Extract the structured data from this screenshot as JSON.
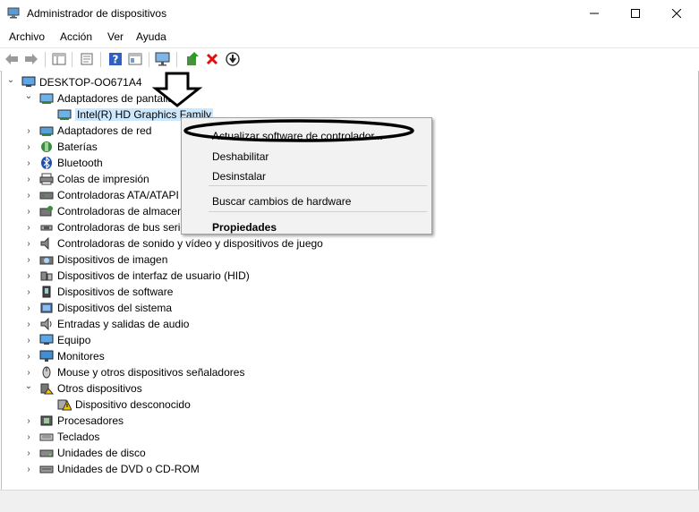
{
  "window": {
    "title": "Administrador de dispositivos",
    "minimize_symbol": "—",
    "maximize_symbol": "☐",
    "close_symbol": "✕"
  },
  "menu": [
    "Archivo",
    "Acción",
    "Ver",
    "Ayuda"
  ],
  "toolbar": {
    "buttons": [
      "back-arrow-icon",
      "forward-arrow-icon",
      "properties-icon",
      "show-hide-icon",
      "help-icon",
      "view-icon",
      "monitor-scan-icon",
      "update-driver-icon",
      "uninstall-x-icon",
      "download-icon"
    ]
  },
  "tree": {
    "root": "DESKTOP-OO671A4",
    "items": [
      {
        "label": "Adaptadores de pantalla",
        "icon": "display-adapter-icon",
        "expanded": true
      },
      {
        "label": "Intel(R) HD Graphics Family",
        "icon": "display-adapter-icon",
        "child": true,
        "selected": true
      },
      {
        "label": "Adaptadores de red",
        "icon": "network-adapter-icon"
      },
      {
        "label": "Baterías",
        "icon": "battery-icon"
      },
      {
        "label": "Bluetooth",
        "icon": "bluetooth-icon"
      },
      {
        "label": "Colas de impresión",
        "icon": "printer-icon"
      },
      {
        "label": "Controladoras ATA/ATAPI",
        "icon": "ata-controller-icon"
      },
      {
        "label": "Controladoras de almacenamiento",
        "icon": "storage-controller-icon"
      },
      {
        "label": "Controladoras de bus serie universal",
        "icon": "usb-icon"
      },
      {
        "label": "Controladoras de sonido y vídeo y dispositivos de juego",
        "icon": "sound-icon"
      },
      {
        "label": "Dispositivos de imagen",
        "icon": "camera-icon"
      },
      {
        "label": "Dispositivos de interfaz de usuario (HID)",
        "icon": "hid-icon"
      },
      {
        "label": "Dispositivos de software",
        "icon": "software-device-icon"
      },
      {
        "label": "Dispositivos del sistema",
        "icon": "system-device-icon"
      },
      {
        "label": "Entradas y salidas de audio",
        "icon": "audio-io-icon"
      },
      {
        "label": "Equipo",
        "icon": "computer-icon"
      },
      {
        "label": "Monitores",
        "icon": "monitor-icon"
      },
      {
        "label": "Mouse y otros dispositivos señaladores",
        "icon": "mouse-icon"
      },
      {
        "label": "Otros dispositivos",
        "icon": "other-devices-icon",
        "expanded": true
      },
      {
        "label": "Dispositivo desconocido",
        "icon": "warning-icon",
        "child": true
      },
      {
        "label": "Procesadores",
        "icon": "processor-icon"
      },
      {
        "label": "Teclados",
        "icon": "keyboard-icon"
      },
      {
        "label": "Unidades de disco",
        "icon": "disk-icon"
      },
      {
        "label": "Unidades de DVD o CD-ROM",
        "icon": "dvd-icon"
      }
    ]
  },
  "context_menu": {
    "items": [
      {
        "label": "Actualizar software de controlador...",
        "bold": false,
        "highlighted": true
      },
      {
        "label": "Deshabilitar",
        "bold": false
      },
      {
        "label": "Desinstalar",
        "bold": false
      },
      {
        "label": "Buscar cambios de hardware",
        "bold": false
      },
      {
        "label": "Propiedades",
        "bold": true
      }
    ]
  },
  "annotation": {
    "arrow": "down-arrow-annotation",
    "ellipse": "highlight-ellipse-annotation"
  }
}
